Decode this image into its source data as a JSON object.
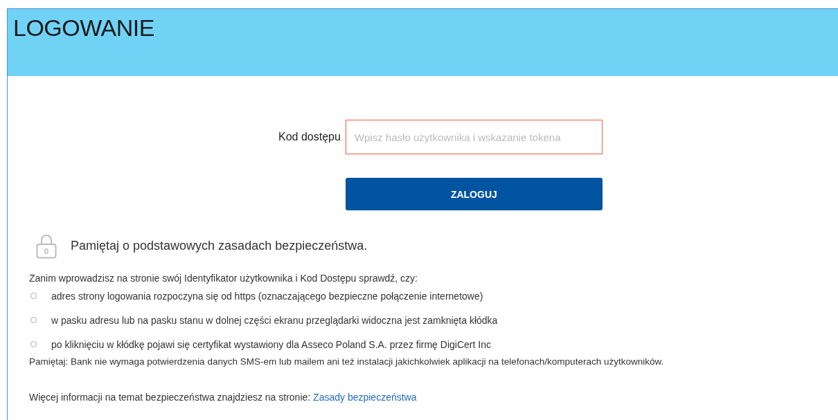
{
  "header": {
    "title": "LOGOWANIE"
  },
  "form": {
    "label": "Kod dostępu",
    "placeholder": "Wpisz hasło użytkownika i wskazanie tokena",
    "button": "ZALOGUJ"
  },
  "security": {
    "heading": "Pamiętaj o podstawowych zasadach bezpieczeństwa.",
    "intro": "Zanim wprowadzisz na stronie swój Identyfikator użytkownika i Kod Dostępu sprawdź, czy:",
    "bullets": [
      "adres strony logowania rozpoczyna się od https (oznaczającego bezpieczne połączenie internetowe)",
      "w pasku adresu lub na pasku stanu w dolnej części ekranu przeglądarki widoczna jest zamknięta kłódka",
      "po kliknięciu w kłódkę pojawi się certyfikat wystawiony dla Asseco Poland S.A. przez firmę DigiCert Inc"
    ],
    "note": "Pamiętaj: Bank nie wymaga potwierdzenia danych SMS-em lub mailem ani też instalacji jakichkolwiek aplikacji na telefonach/komputerach użytkowników.",
    "more": "Więcej informacji na temat bezpieczeństwa znajdziesz na stronie:",
    "link": "Zasady bezpieczeństwa"
  }
}
